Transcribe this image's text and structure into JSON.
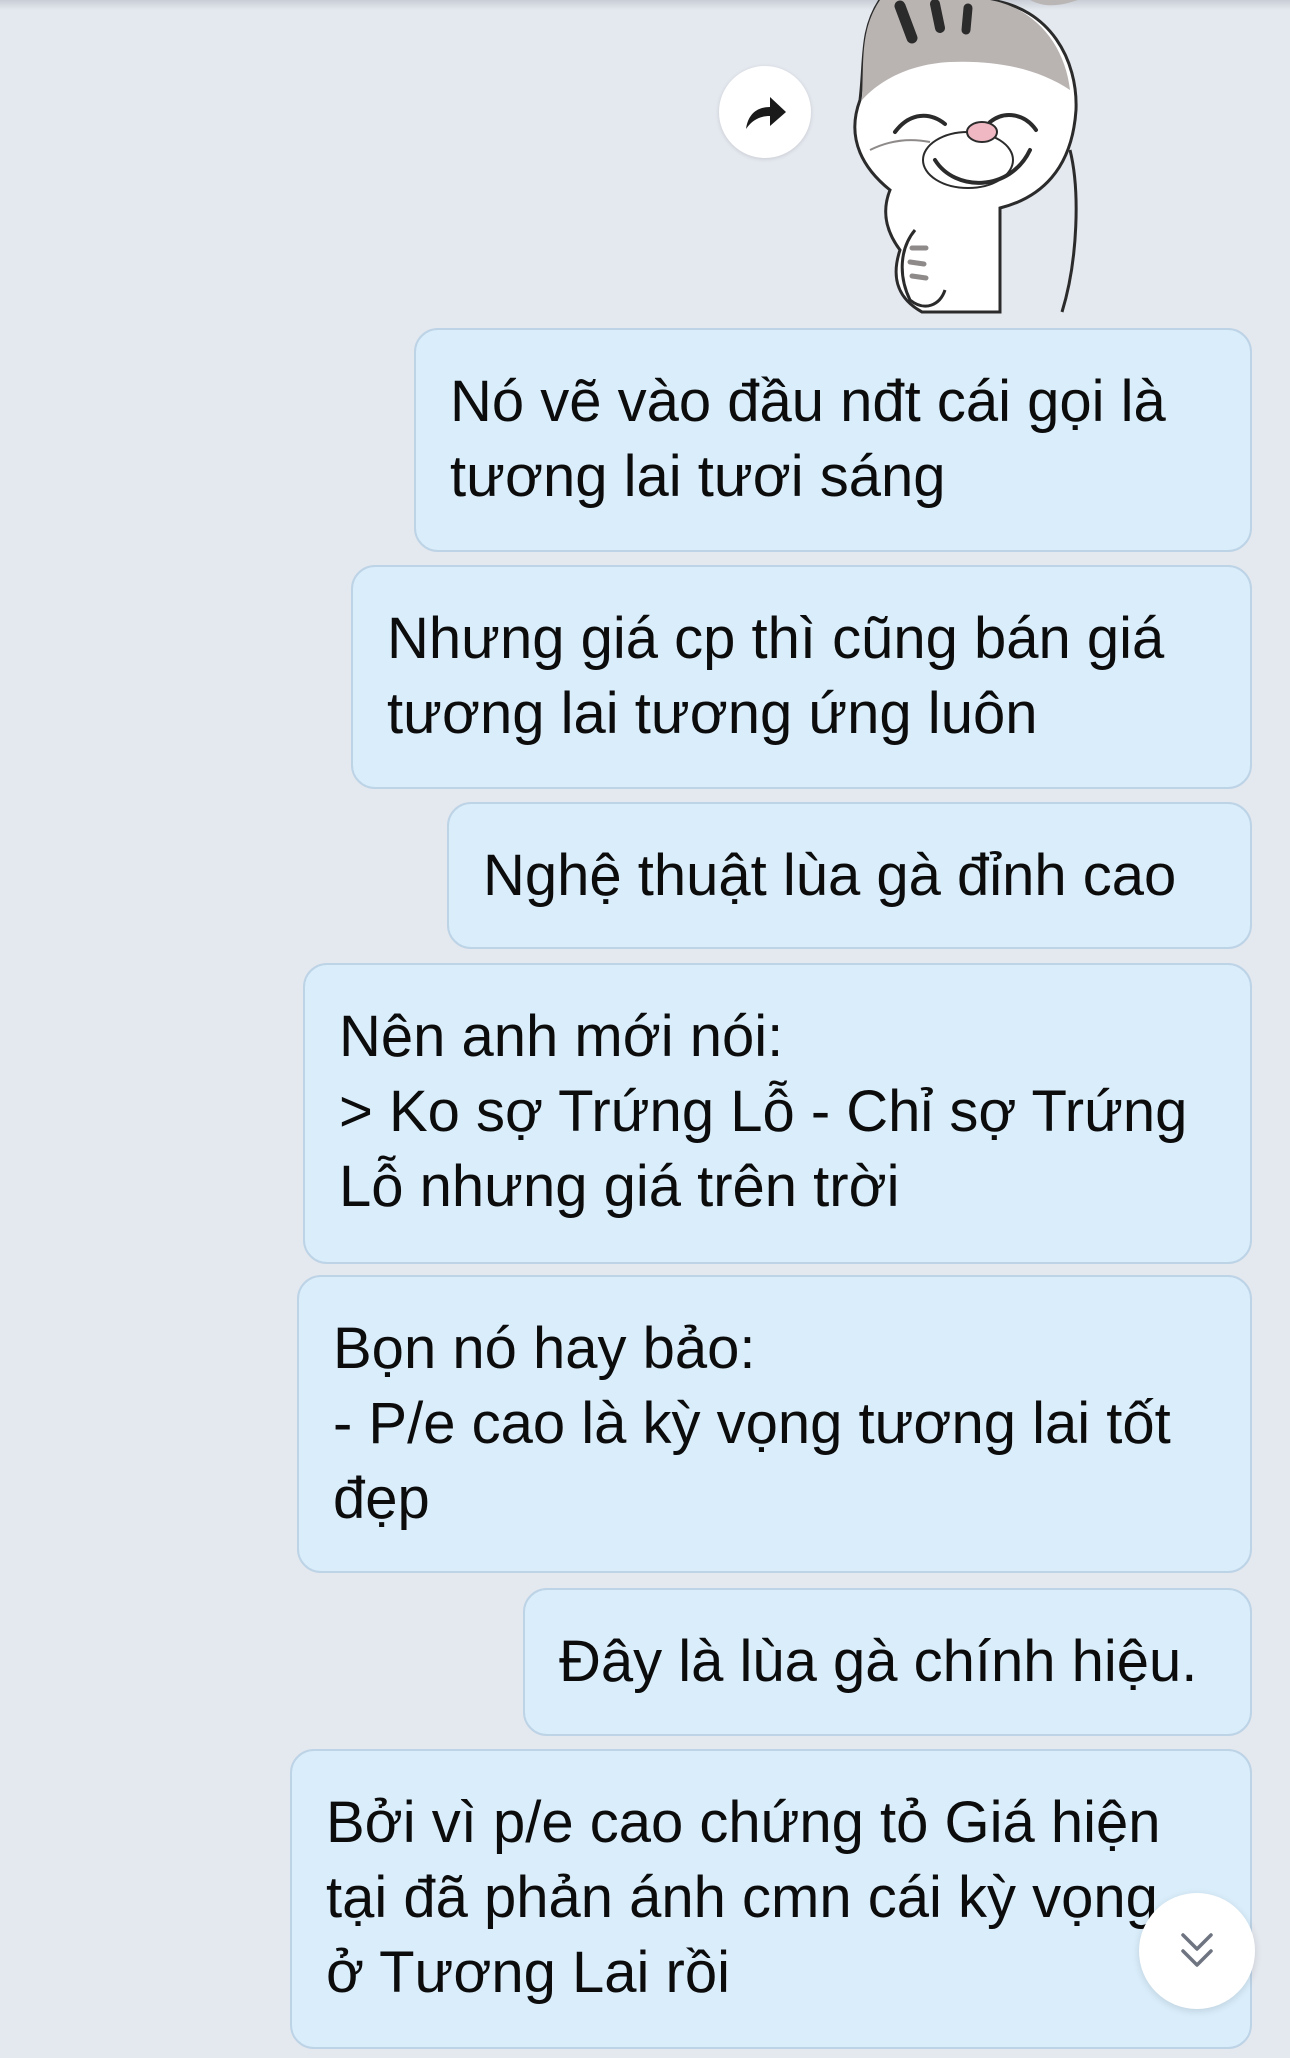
{
  "chat": {
    "sticker": {
      "icon": "smug-cat-sticker"
    },
    "forward_button": {
      "icon": "forward-arrow-icon"
    },
    "messages": [
      {
        "text": "Nó vẽ vào đầu nđt cái gọi là\ntương lai tươi sáng"
      },
      {
        "text": "Nhưng giá cp thì cũng bán giá\ntương lai tương ứng luôn"
      },
      {
        "text": "Nghệ thuật lùa gà đỉnh cao"
      },
      {
        "text": "Nên anh mới nói:\n> Ko sợ Trứng Lỗ - Chỉ sợ Trứng\nLỗ nhưng giá trên trời"
      },
      {
        "text": "Bọn nó hay bảo:\n- P/e cao là kỳ vọng tương lai tốt\nđẹp"
      },
      {
        "text": "Đây là lùa gà chính hiệu."
      },
      {
        "text": "Bởi vì p/e cao chứng tỏ Giá hiện\ntại đã phản ánh cmn cái kỳ vọng\nở Tương Lai rồi"
      }
    ],
    "scroll_down_button": {
      "icon": "double-chevron-down-icon"
    },
    "colors": {
      "background": "#e4e8ef",
      "bubble": "#d9edfb",
      "bubble_border": "#bdd3e6",
      "text": "#0c0c0c"
    }
  }
}
